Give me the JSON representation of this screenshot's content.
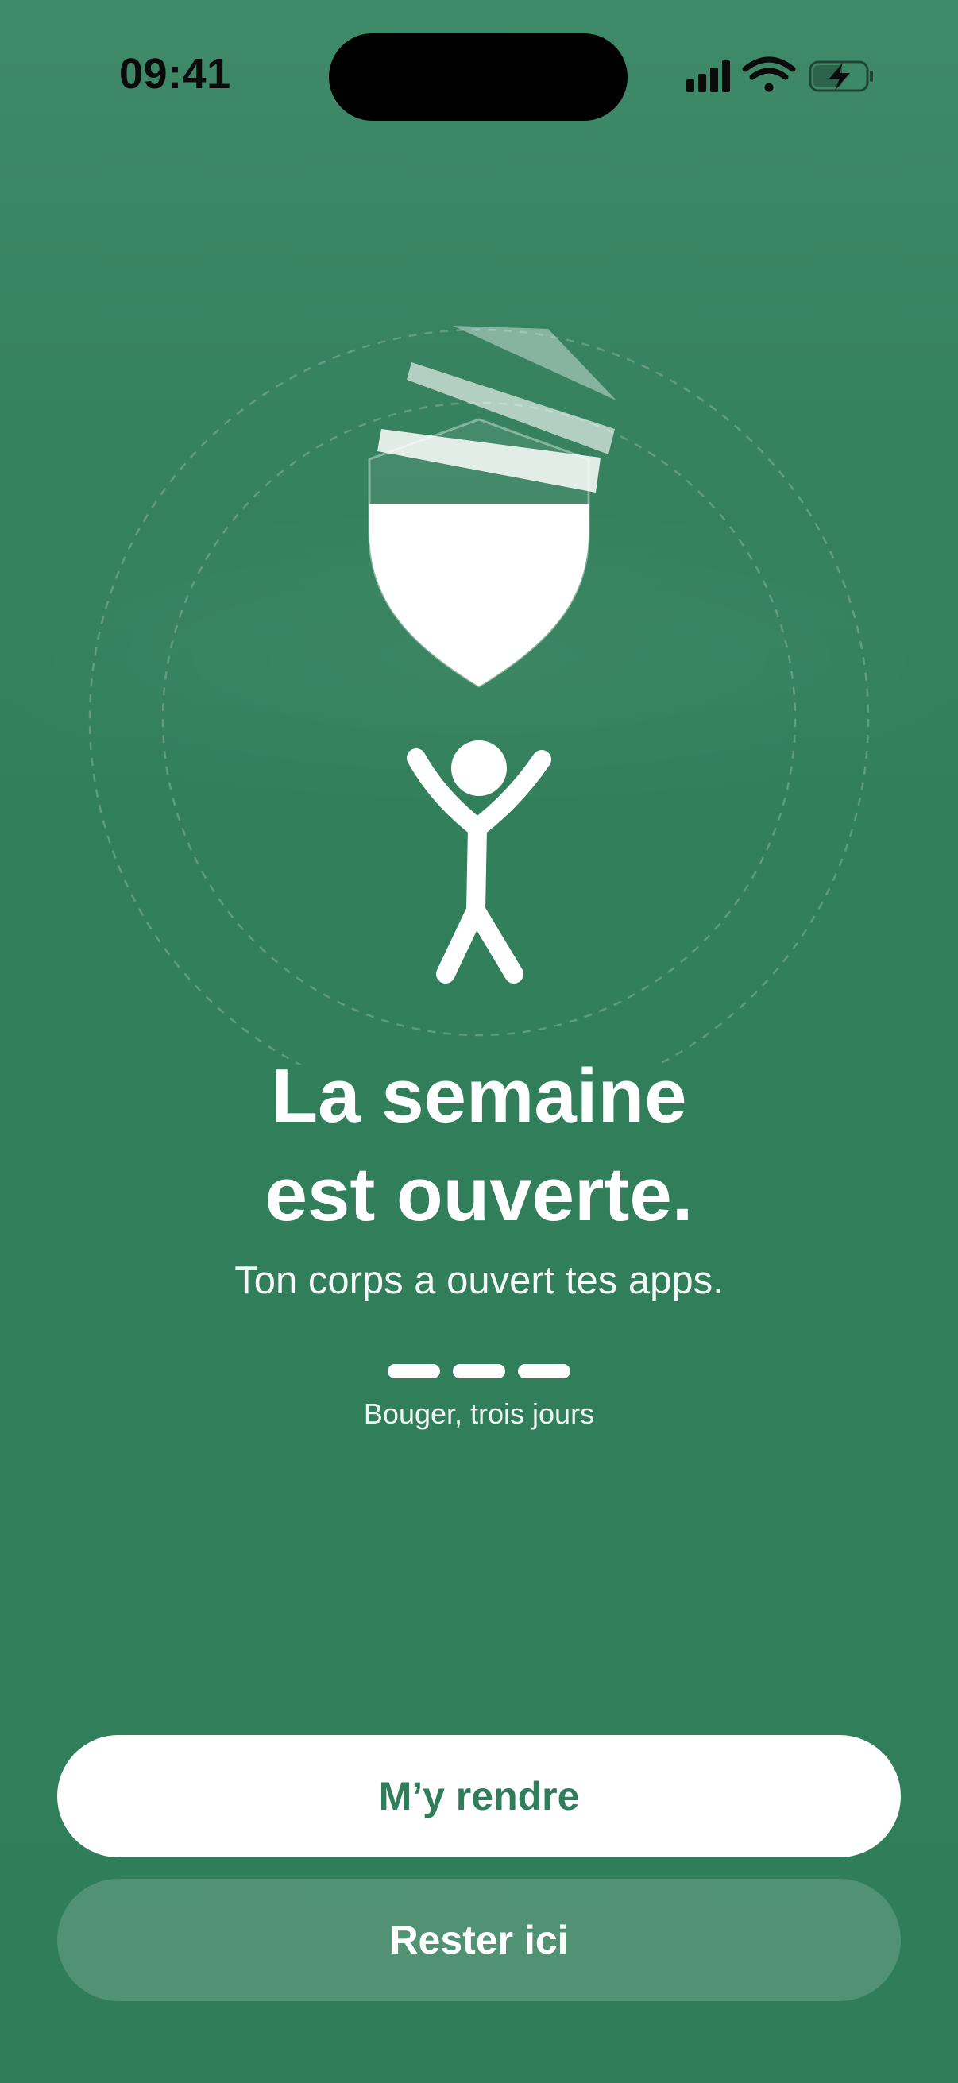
{
  "status_bar": {
    "time": "09:41",
    "icons": [
      "cellular-signal-icon",
      "wifi-icon",
      "battery-charging-icon"
    ]
  },
  "illustration": {
    "icons": [
      "shield-icon",
      "shield-lid-icon",
      "person-arms-up-icon"
    ]
  },
  "main": {
    "headline_line1": "La semaine",
    "headline_line2": "est ouverte.",
    "subtitle": "Ton corps a ouvert tes apps.",
    "progress": {
      "completed_days": 3,
      "total_days": 3,
      "caption": "Bouger, trois jours"
    }
  },
  "actions": {
    "primary_label": "M’y rendre",
    "secondary_label": "Rester ici"
  },
  "colors": {
    "background": "#317f5b",
    "primary_button_bg": "#ffffff",
    "primary_button_text": "#2f7e59",
    "text": "#ffffff"
  }
}
